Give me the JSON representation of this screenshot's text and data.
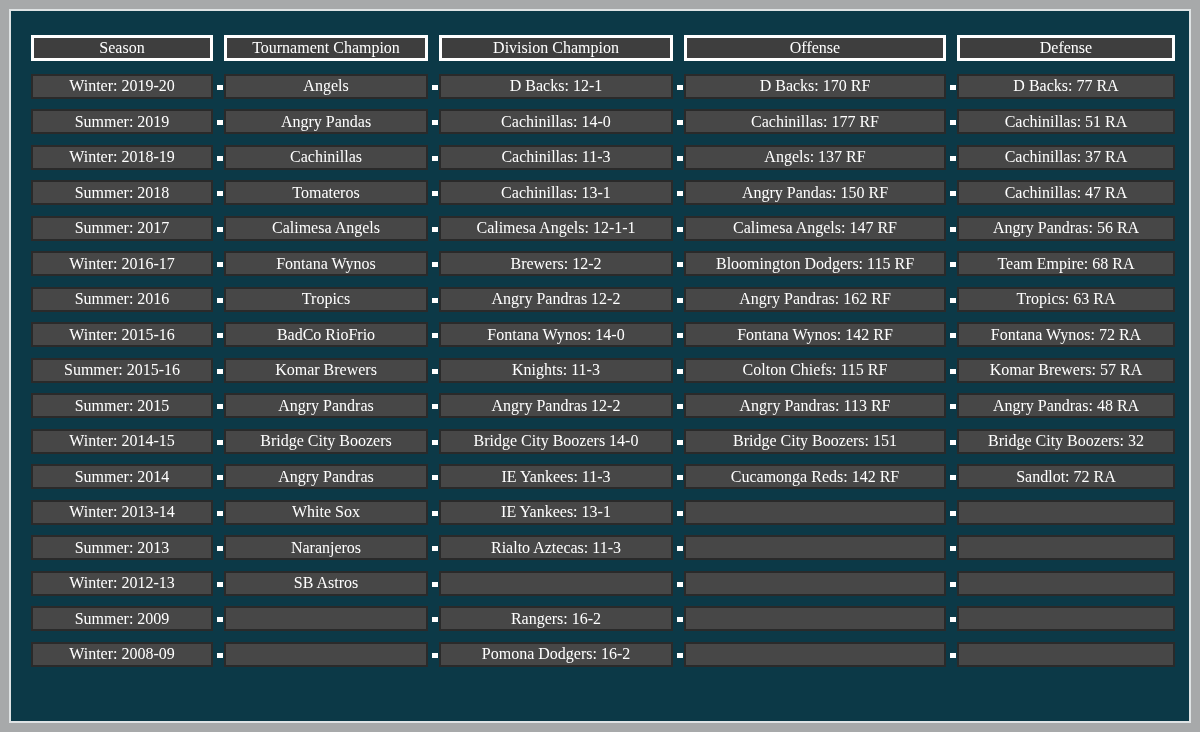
{
  "columns": [
    "Season",
    "Tournament Champion",
    "Division Champion",
    "Offense",
    "Defense"
  ],
  "rows": [
    {
      "season": "Winter: 2019-20",
      "tournament": "Angels",
      "division": "D Backs: 12-1",
      "offense": "D Backs: 170 RF",
      "defense": "D Backs: 77 RA"
    },
    {
      "season": "Summer: 2019",
      "tournament": "Angry Pandas",
      "division": "Cachinillas: 14-0",
      "offense": "Cachinillas: 177 RF",
      "defense": "Cachinillas: 51 RA"
    },
    {
      "season": "Winter: 2018-19",
      "tournament": "Cachinillas",
      "division": "Cachinillas: 11-3",
      "offense": "Angels: 137 RF",
      "defense": "Cachinillas: 37 RA"
    },
    {
      "season": "Summer: 2018",
      "tournament": "Tomateros",
      "division": "Cachinillas: 13-1",
      "offense": "Angry Pandas: 150 RF",
      "defense": "Cachinillas: 47 RA"
    },
    {
      "season": "Summer: 2017",
      "tournament": "Calimesa Angels",
      "division": "Calimesa Angels: 12-1-1",
      "offense": "Calimesa Angels: 147 RF",
      "defense": "Angry Pandras: 56 RA"
    },
    {
      "season": "Winter: 2016-17",
      "tournament": "Fontana Wynos",
      "division": "Brewers: 12-2",
      "offense": "Bloomington Dodgers: 115 RF",
      "defense": "Team Empire: 68 RA"
    },
    {
      "season": "Summer: 2016",
      "tournament": "Tropics",
      "division": "Angry Pandras 12-2",
      "offense": "Angry Pandras: 162 RF",
      "defense": "Tropics: 63 RA"
    },
    {
      "season": "Winter: 2015-16",
      "tournament": "BadCo RioFrio",
      "division": "Fontana Wynos: 14-0",
      "offense": "Fontana Wynos: 142 RF",
      "defense": "Fontana Wynos: 72 RA"
    },
    {
      "season": "Summer: 2015-16",
      "tournament": "Komar Brewers",
      "division": "Knights: 11-3",
      "offense": "Colton Chiefs: 115 RF",
      "defense": "Komar Brewers: 57 RA"
    },
    {
      "season": "Summer: 2015",
      "tournament": "Angry Pandras",
      "division": "Angry Pandras 12-2",
      "offense": "Angry Pandras: 113 RF",
      "defense": "Angry Pandras: 48 RA"
    },
    {
      "season": "Winter: 2014-15",
      "tournament": "Bridge City Boozers",
      "division": "Bridge City Boozers 14-0",
      "offense": "Bridge City Boozers: 151",
      "defense": "Bridge City Boozers: 32"
    },
    {
      "season": "Summer: 2014",
      "tournament": "Angry Pandras",
      "division": "IE Yankees: 11-3",
      "offense": "Cucamonga Reds: 142 RF",
      "defense": "Sandlot: 72 RA"
    },
    {
      "season": "Winter: 2013-14",
      "tournament": "White Sox",
      "division": "IE Yankees: 13-1"
    },
    {
      "season": "Summer: 2013",
      "tournament": "Naranjeros",
      "division": "Rialto Aztecas: 11-3"
    },
    {
      "season": "Winter: 2012-13",
      "tournament": "SB Astros"
    },
    {
      "season": "Summer: 2009",
      "division": "Rangers: 16-2"
    },
    {
      "season": "Winter: 2008-09",
      "division": "Pomona Dodgers: 16-2"
    }
  ]
}
